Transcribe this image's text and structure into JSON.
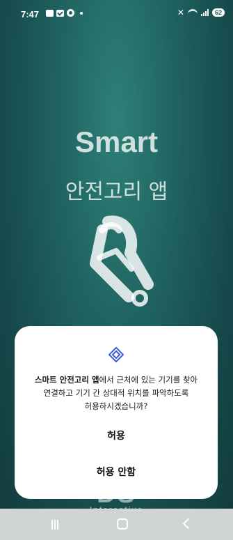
{
  "status_bar": {
    "time": "7:47",
    "battery": "62",
    "icons": [
      "gallery-icon",
      "check-box-icon",
      "settings-icon",
      "dot-icon",
      "mute-icon",
      "wifi-icon",
      "signal-icon",
      "battery-icon"
    ]
  },
  "splash": {
    "title": "Smart",
    "subtitle": "안전고리 앱",
    "logo_icon": "carabiner-icon",
    "brand_partial": "DS",
    "brand_sub": "Interactive"
  },
  "dialog": {
    "icon": "nearby-devices-icon",
    "app_name": "스마트 안전고리 앱",
    "message_line1_rest": "에서 근처에 있는 기기를 찾아",
    "message_line2": "연결하고 기기 간 상대적 위치를 파악하도록",
    "message_line3": "허용하시겠습니까?",
    "allow_label": "허용",
    "deny_label": "허용 안함"
  },
  "nav_bar": {
    "icons": [
      "recents-icon",
      "home-icon",
      "back-icon"
    ]
  },
  "colors": {
    "background": "#1f625f",
    "accent": "#3a5bd9",
    "dialog": "#ffffff",
    "nav_bar": "#d0d4d4"
  }
}
